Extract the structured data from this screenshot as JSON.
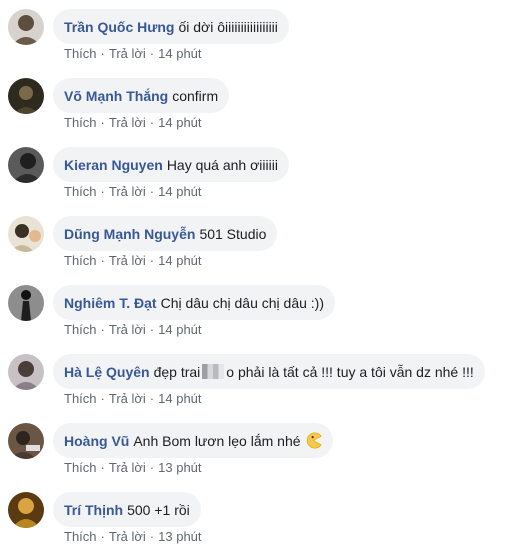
{
  "action_labels": {
    "like": "Thích",
    "reply": "Trả lời",
    "separator": "·"
  },
  "comments": [
    {
      "author": "Trần Quốc Hưng",
      "text": "ối dời ôiiiiiiiiiiiiiiiii",
      "time": "14 phút",
      "avatar_icon": "user-avatar",
      "avatar_color": "#6b5a4a"
    },
    {
      "author": "Võ Mạnh Thắng",
      "text": "confirm",
      "time": "14 phút",
      "avatar_icon": "user-avatar",
      "avatar_color": "#3a3426"
    },
    {
      "author": "Kieran Nguyen",
      "text": "Hay quá anh ơiiiiii",
      "time": "14 phút",
      "avatar_icon": "user-avatar",
      "avatar_color": "#2b2b2b"
    },
    {
      "author": "Dũng Mạnh Nguyễn",
      "text": "501 Studio",
      "time": "14 phút",
      "avatar_icon": "user-avatar",
      "avatar_color": "#c9b79a"
    },
    {
      "author": "Nghiêm T. Đạt",
      "text": "Chị dâu chị dâu chị dâu :))",
      "time": "14 phút",
      "avatar_icon": "user-avatar",
      "avatar_color": "#1e1e1e"
    },
    {
      "author": "Hà Lệ Quyên",
      "text_before": "đẹp trai",
      "text_after": "o phải là tất cả !!! tuy a tôi vẫn dz nhé !!!",
      "time": "14 phút",
      "avatar_icon": "user-avatar",
      "avatar_color": "#8a7f86"
    },
    {
      "author": "Hoàng Vũ",
      "text": "Anh Bom lươn lẹo lắm nhé",
      "emoji_icon": "pacman-emoji-icon",
      "time": "13 phút",
      "avatar_icon": "user-avatar",
      "avatar_color": "#4a3a32"
    },
    {
      "author": "Trí Thịnh",
      "text": "500 +1 rồi",
      "time": "13 phút",
      "avatar_icon": "user-avatar",
      "avatar_color": "#b8861c"
    }
  ]
}
